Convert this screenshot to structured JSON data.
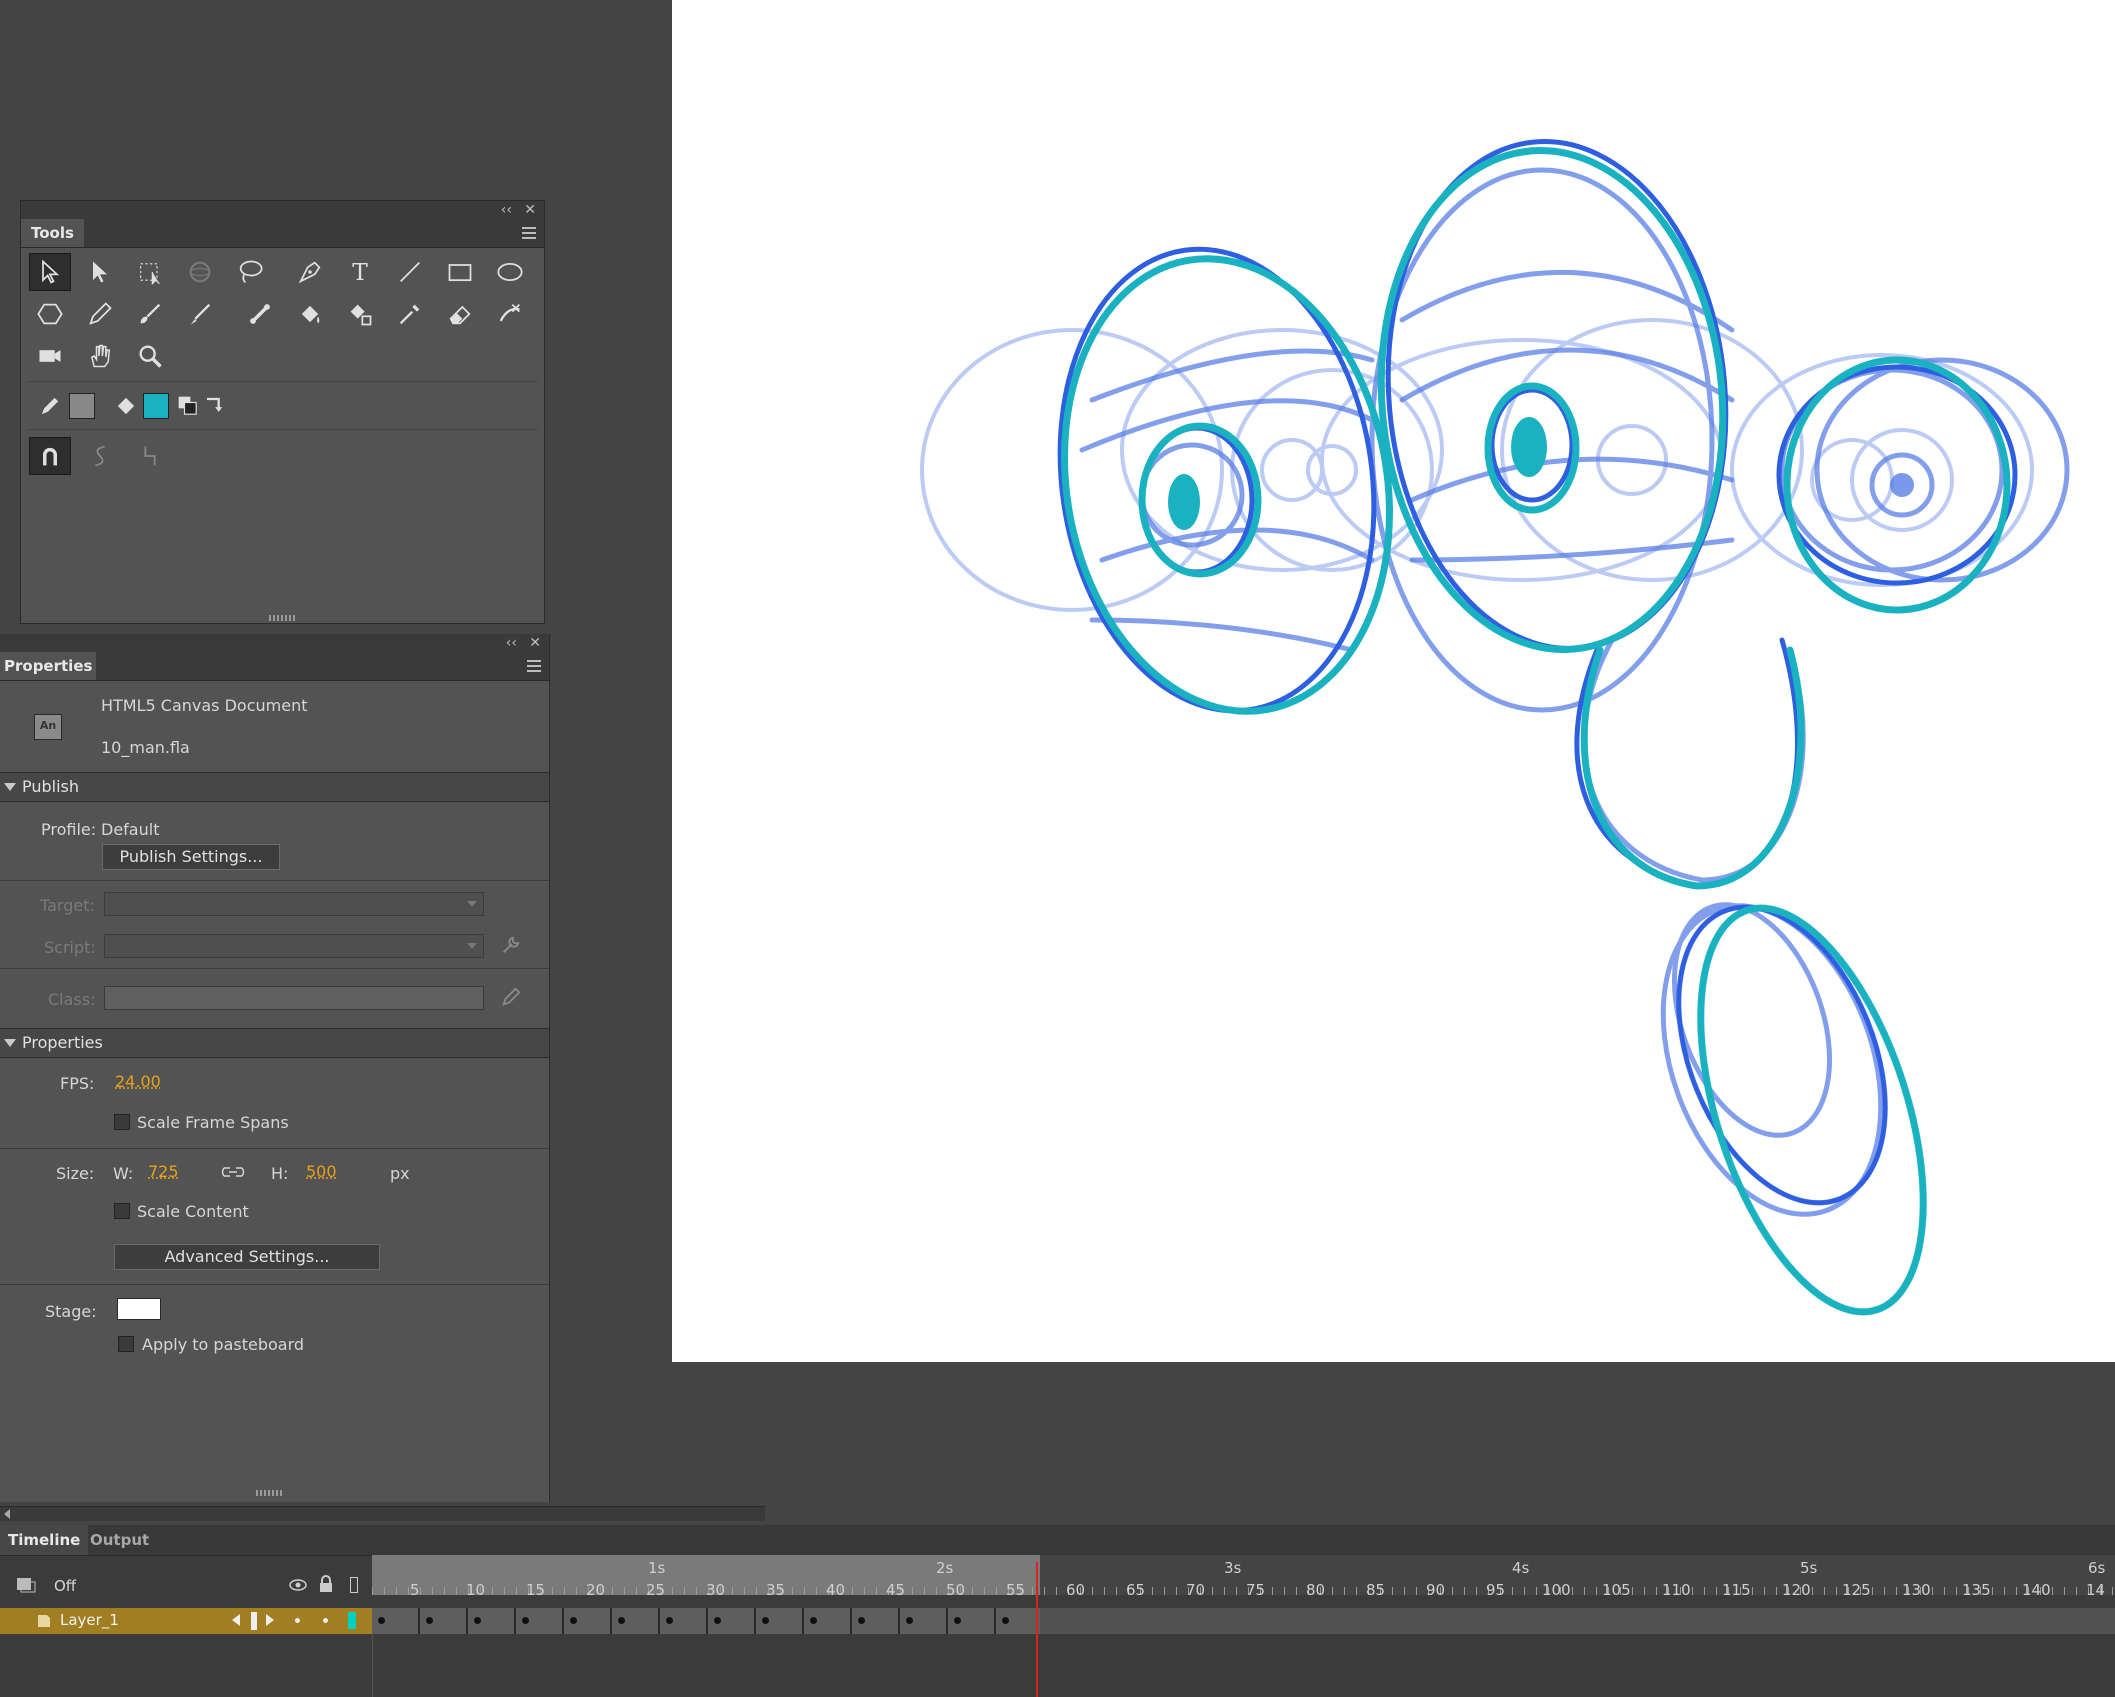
{
  "tools_panel": {
    "title": "Tools",
    "collapse_label": "‹‹",
    "close_label": "✕"
  },
  "properties_panel": {
    "title": "Properties",
    "collapse_label": "‹‹",
    "close_label": "✕",
    "document_type": "HTML5 Canvas Document",
    "doc_icon_label": "An",
    "file_name": "10_man.fla",
    "publish": {
      "header": "Publish",
      "profile_label": "Profile:",
      "profile_value": "Default",
      "settings_button": "Publish Settings...",
      "target_label": "Target:",
      "script_label": "Script:",
      "class_label": "Class:"
    },
    "properties": {
      "header": "Properties",
      "fps_label": "FPS:",
      "fps_value": "24.00",
      "scale_frame_spans": "Scale Frame Spans",
      "size_label": "Size:",
      "w_label": "W:",
      "w_value": "725",
      "h_label": "H:",
      "h_value": "500",
      "unit": "px",
      "scale_content": "Scale Content",
      "advanced_button": "Advanced Settings...",
      "stage_label": "Stage:",
      "apply_pasteboard": "Apply to pasteboard",
      "stage_color": "#ffffff"
    }
  },
  "timeline": {
    "tabs": [
      "Timeline",
      "Output"
    ],
    "onion_label": "Off",
    "layer_name": "Layer_1",
    "seconds": [
      "1s",
      "2s",
      "3s",
      "4s",
      "5s",
      "6s"
    ],
    "frame_numbers": [
      "5",
      "10",
      "15",
      "20",
      "25",
      "30",
      "35",
      "40",
      "45",
      "50",
      "55",
      "60",
      "65",
      "70",
      "75",
      "80",
      "85",
      "90",
      "95",
      "100",
      "105",
      "110",
      "115",
      "120",
      "125",
      "130",
      "135",
      "140",
      "14"
    ],
    "layer_color": "#00d0c0"
  },
  "colors": {
    "accent": "#e5a217",
    "fill_color": "#1ab2c0",
    "stroke_color": "#888888",
    "layer_highlight": "#a17e22"
  }
}
